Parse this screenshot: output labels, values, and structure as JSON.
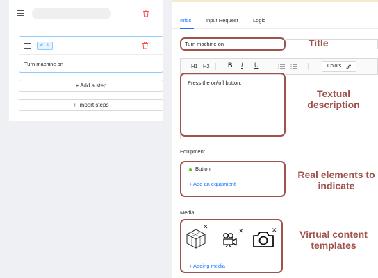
{
  "left": {
    "step": {
      "tag": "#1.1",
      "title": "Turn machine on"
    },
    "add_step_label": "+ Add a step",
    "import_steps_label": "+ Import steps"
  },
  "tabs": [
    {
      "label": "Infos",
      "active": true
    },
    {
      "label": "Input Request",
      "active": false
    },
    {
      "label": "Logic",
      "active": false
    }
  ],
  "form": {
    "title_value": "Turn machine on",
    "toolbar": {
      "h1": "H1",
      "h2": "H2",
      "bold": "B",
      "italic": "I",
      "underline": "U",
      "colors": "Colors"
    },
    "description": "Press the on/off button.",
    "equipment_label": "Equipment",
    "equipment_items": [
      "Button"
    ],
    "add_equipment": "+ Add an equipment",
    "media_label": "Media",
    "add_media": "+ Adding media"
  },
  "annotations": {
    "title": "Title",
    "textual": "Textual description",
    "real": "Real elements to indicate",
    "virtual": "Virtual content templates"
  },
  "colors": {
    "accent": "#1677ff",
    "annotation": "#a0524d",
    "delete": "#ff4d4f",
    "equipment_dot": "#52c41a"
  },
  "icons": [
    "menu-icon",
    "delete-icon",
    "cube-icon",
    "video-camera-icon",
    "photo-camera-icon",
    "close-icon"
  ]
}
